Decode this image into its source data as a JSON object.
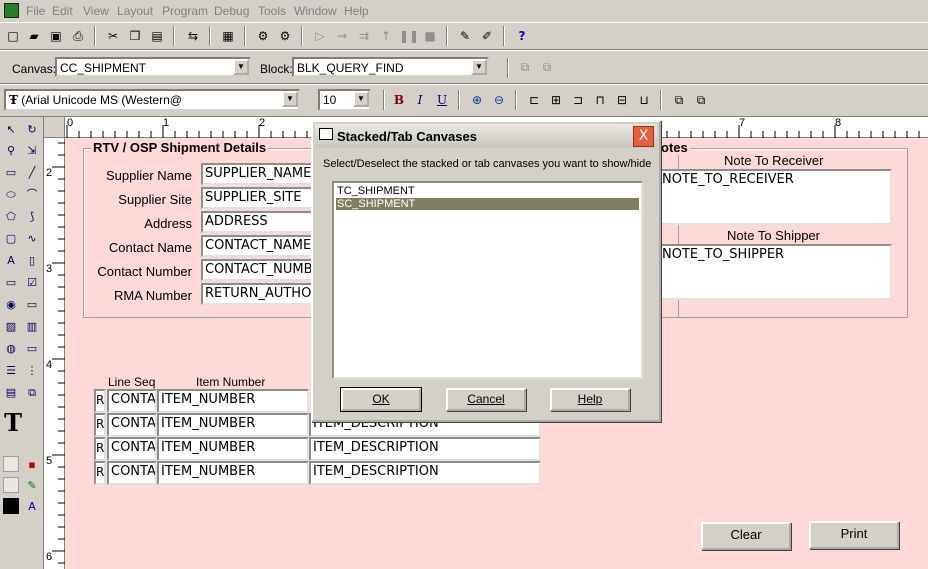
{
  "menu": {
    "items": [
      "File",
      "Edit",
      "View",
      "Layout",
      "Program",
      "Debug",
      "Tools",
      "Window",
      "Help"
    ]
  },
  "toolbar2": {
    "canvas_label": "Canvas:",
    "canvas_value": "CC_SHIPMENT",
    "block_label": "Block:",
    "block_value": "BLK_QUERY_FIND"
  },
  "toolbar3": {
    "font_value": "(Arial Unicode MS (Western@",
    "size_value": "10",
    "bold": "B",
    "italic": "I",
    "underline": "U"
  },
  "ruler": {
    "h_ticks": [
      "0",
      "1",
      "2",
      "7",
      "8"
    ],
    "v_ticks": [
      "2",
      "3",
      "4",
      "5",
      "6"
    ]
  },
  "form": {
    "frame1_title": "RTV / OSP Shipment Details",
    "labels": [
      "Supplier Name",
      "Supplier Site",
      "Address",
      "Contact Name",
      "Contact Number",
      "RMA Number"
    ],
    "fields": [
      "SUPPLIER_NAME",
      "SUPPLIER_SITE",
      "ADDRESS",
      "CONTACT_NAME",
      "CONTACT_NUMB",
      "RETURN_AUTHOR"
    ],
    "frame2_title": "otes",
    "note_receiver_label": "Note To Receiver",
    "note_receiver_value": "NOTE_TO_RECEIVER",
    "note_shipper_label": "Note To Shipper",
    "note_shipper_value": "NOTE_TO_SHIPPER",
    "col_line_seq": "Line Seq",
    "col_item_number": "Item Number",
    "rows": [
      {
        "r": "R",
        "seq": "CONTA",
        "item": "ITEM_NUMBER",
        "desc": ""
      },
      {
        "r": "R",
        "seq": "CONTA",
        "item": "ITEM_NUMBER",
        "desc": "ITEM_DESCRIPTION"
      },
      {
        "r": "R",
        "seq": "CONTA",
        "item": "ITEM_NUMBER",
        "desc": "ITEM_DESCRIPTION"
      },
      {
        "r": "R",
        "seq": "CONTA",
        "item": "ITEM_NUMBER",
        "desc": "ITEM_DESCRIPTION"
      }
    ],
    "clear_label": "Clear",
    "print_label": "Print"
  },
  "dialog": {
    "title": "Stacked/Tab Canvases",
    "close": "X",
    "prompt": "Select/Deselect the stacked or tab canvases you want to show/hide",
    "items": [
      {
        "label": "TC_SHIPMENT",
        "selected": false
      },
      {
        "label": "SC_SHIPMENT",
        "selected": true
      }
    ],
    "ok": "OK",
    "cancel": "Cancel",
    "help": "Help"
  },
  "palette": {
    "text_tool": "T"
  }
}
